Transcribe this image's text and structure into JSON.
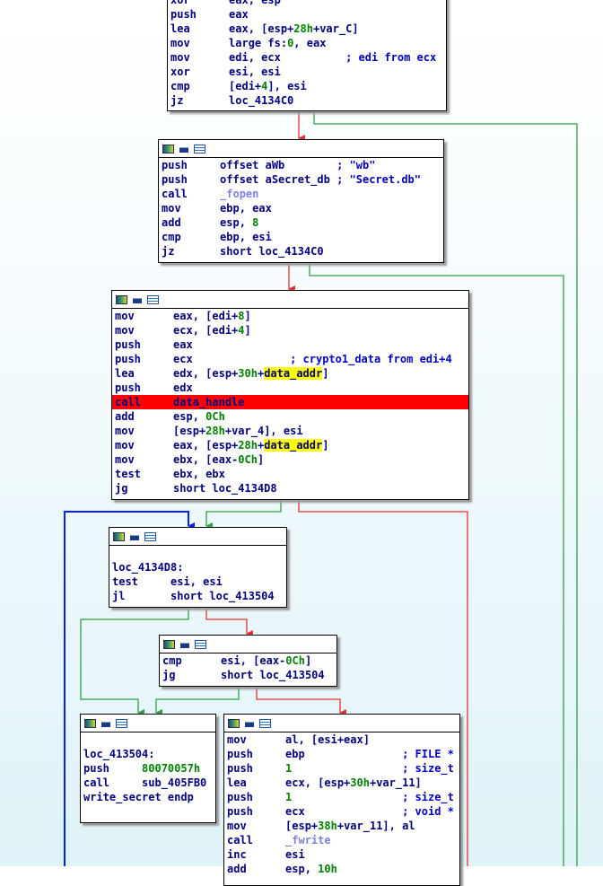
{
  "colors": {
    "true_edge": "#2ea043",
    "false_edge": "#e83030",
    "loop_edge": "#0020ff",
    "highlight": "#ff0000"
  },
  "header_icons": [
    "graph-color-icon",
    "node-rename-icon",
    "node-text-icon"
  ],
  "blocks": [
    {
      "id": "block-entry",
      "lines": [
        {
          "m": "xor",
          "o": [
            [
              "eax, esp",
              ""
            ]
          ]
        },
        {
          "m": "push",
          "o": [
            [
              "eax",
              ""
            ]
          ]
        },
        {
          "m": "lea",
          "o": [
            [
              "eax, [esp+",
              ""
            ],
            [
              "28h",
              "n"
            ],
            [
              "+var_C]",
              ""
            ]
          ]
        },
        {
          "m": "mov",
          "o": [
            [
              "large fs:",
              ""
            ],
            [
              "0",
              "n"
            ],
            [
              ", eax",
              ""
            ]
          ]
        },
        {
          "m": "mov",
          "o": [
            [
              "edi, ecx",
              ""
            ]
          ],
          "c": "; edi from ecx"
        },
        {
          "m": "xor",
          "o": [
            [
              "esi, esi",
              ""
            ]
          ]
        },
        {
          "m": "cmp",
          "o": [
            [
              "[edi+",
              ""
            ],
            [
              "4",
              "n"
            ],
            [
              "], esi",
              ""
            ]
          ]
        },
        {
          "m": "jz",
          "o": [
            [
              "loc_4134C0",
              ""
            ]
          ]
        }
      ]
    },
    {
      "id": "block-fopen",
      "lines": [
        {
          "m": "push",
          "o": [
            [
              "offset aWb",
              ""
            ]
          ],
          "c": "; \"wb\""
        },
        {
          "m": "push",
          "o": [
            [
              "offset aSecret_db",
              ""
            ]
          ],
          "c": "; \"Secret.db\""
        },
        {
          "m": "call",
          "o": [
            [
              "_fopen",
              "f"
            ]
          ]
        },
        {
          "m": "mov",
          "o": [
            [
              "ebp, eax",
              ""
            ]
          ]
        },
        {
          "m": "add",
          "o": [
            [
              "esp, ",
              ""
            ],
            [
              "8",
              "n"
            ]
          ]
        },
        {
          "m": "cmp",
          "o": [
            [
              "ebp, esi",
              ""
            ]
          ]
        },
        {
          "m": "jz",
          "o": [
            [
              "short loc_4134C0",
              ""
            ]
          ]
        }
      ]
    },
    {
      "id": "block-data-handle",
      "lines": [
        {
          "m": "mov",
          "o": [
            [
              "eax, [edi+",
              ""
            ],
            [
              "8",
              "n"
            ],
            [
              "]",
              ""
            ]
          ]
        },
        {
          "m": "mov",
          "o": [
            [
              "ecx, [edi+",
              ""
            ],
            [
              "4",
              "n"
            ],
            [
              "]",
              ""
            ]
          ]
        },
        {
          "m": "push",
          "o": [
            [
              "eax",
              ""
            ]
          ]
        },
        {
          "m": "push",
          "o": [
            [
              "ecx",
              ""
            ]
          ],
          "c": "; crypto1_data from edi+4"
        },
        {
          "m": "lea",
          "o": [
            [
              "edx, [esp+",
              ""
            ],
            [
              "30h",
              "n"
            ],
            [
              "+",
              ""
            ],
            [
              "data_addr",
              "y"
            ],
            [
              "]",
              ""
            ]
          ]
        },
        {
          "m": "push",
          "o": [
            [
              "edx",
              ""
            ]
          ]
        },
        {
          "m": "call",
          "o": [
            [
              "data_handle",
              ""
            ]
          ],
          "hl": true
        },
        {
          "m": "add",
          "o": [
            [
              "esp, ",
              ""
            ],
            [
              "0Ch",
              "n"
            ]
          ]
        },
        {
          "m": "mov",
          "o": [
            [
              "[esp+",
              ""
            ],
            [
              "28h",
              "n"
            ],
            [
              "+var_4], esi",
              ""
            ]
          ]
        },
        {
          "m": "mov",
          "o": [
            [
              "eax, [esp+",
              ""
            ],
            [
              "28h",
              "n"
            ],
            [
              "+",
              ""
            ],
            [
              "data_addr",
              "y"
            ],
            [
              "]",
              ""
            ]
          ]
        },
        {
          "m": "mov",
          "o": [
            [
              "ebx, [eax-",
              ""
            ],
            [
              "0Ch",
              "n"
            ],
            [
              "]",
              ""
            ]
          ]
        },
        {
          "m": "test",
          "o": [
            [
              "ebx, ebx",
              ""
            ]
          ]
        },
        {
          "m": "jg",
          "o": [
            [
              "short loc_4134D8",
              ""
            ]
          ]
        }
      ]
    },
    {
      "id": "block-loc-4134d8",
      "lines": [
        {
          "m": "",
          "o": []
        },
        {
          "label": "loc_4134D8:"
        },
        {
          "m": "test",
          "o": [
            [
              "esi, esi",
              ""
            ]
          ]
        },
        {
          "m": "jl",
          "o": [
            [
              "short loc_413504",
              ""
            ]
          ]
        }
      ]
    },
    {
      "id": "block-cmp",
      "lines": [
        {
          "m": "cmp",
          "o": [
            [
              "esi, [eax-",
              ""
            ],
            [
              "0Ch",
              "n"
            ],
            [
              "]",
              ""
            ]
          ]
        },
        {
          "m": "jg",
          "o": [
            [
              "short loc_413504",
              ""
            ]
          ]
        }
      ]
    },
    {
      "id": "block-loc-413504",
      "lines": [
        {
          "m": "",
          "o": []
        },
        {
          "label": "loc_413504:"
        },
        {
          "m": "push",
          "o": [
            [
              "80070057h",
              "n"
            ]
          ]
        },
        {
          "m": "call",
          "o": [
            [
              "sub_405FB0",
              ""
            ]
          ]
        },
        {
          "label": "write_secret endp"
        }
      ]
    },
    {
      "id": "block-fwrite",
      "lines": [
        {
          "m": "mov",
          "o": [
            [
              "al, [esi+eax]",
              ""
            ]
          ]
        },
        {
          "m": "push",
          "o": [
            [
              "ebp",
              ""
            ]
          ],
          "c": "; FILE *"
        },
        {
          "m": "push",
          "o": [
            [
              "1",
              "n"
            ]
          ],
          "c": "; size_t"
        },
        {
          "m": "lea",
          "o": [
            [
              "ecx, [esp+",
              ""
            ],
            [
              "30h",
              "n"
            ],
            [
              "+var_11]",
              ""
            ]
          ]
        },
        {
          "m": "push",
          "o": [
            [
              "1",
              "n"
            ]
          ],
          "c": "; size_t"
        },
        {
          "m": "push",
          "o": [
            [
              "ecx",
              ""
            ]
          ],
          "c": "; void *"
        },
        {
          "m": "mov",
          "o": [
            [
              "[esp+",
              ""
            ],
            [
              "38h",
              "n"
            ],
            [
              "+var_11], al",
              ""
            ]
          ]
        },
        {
          "m": "call",
          "o": [
            [
              "_fwrite",
              "f"
            ]
          ]
        },
        {
          "m": "inc",
          "o": [
            [
              "esi",
              ""
            ]
          ]
        },
        {
          "m": "add",
          "o": [
            [
              "esp, ",
              ""
            ],
            [
              "10h",
              "n"
            ]
          ]
        }
      ]
    }
  ]
}
